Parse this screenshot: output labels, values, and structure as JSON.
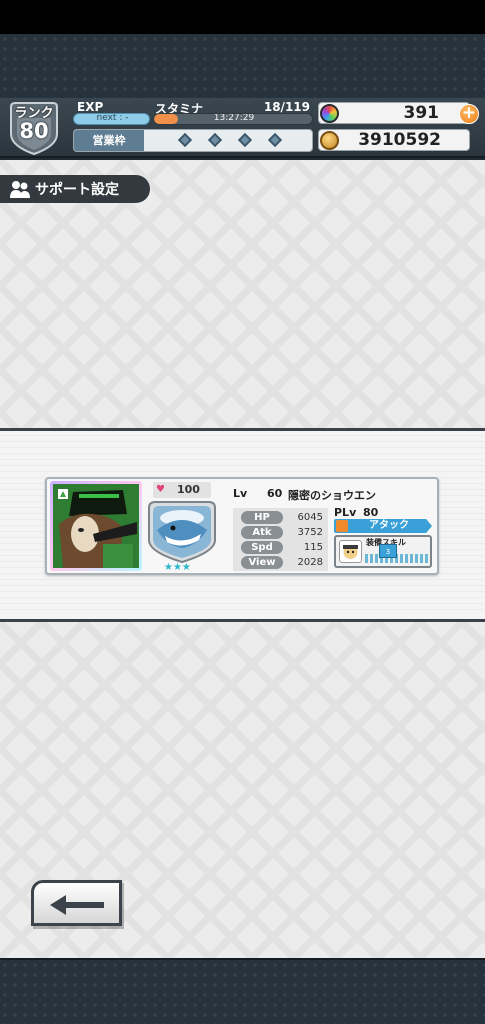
{
  "header": {
    "rank_label": "ランク",
    "rank_value": "80",
    "exp_label": "EXP",
    "exp_next": "next :  -",
    "stamina_label": "スタミナ",
    "stamina_count": "18/119",
    "stamina_fraction": 0.15,
    "stamina_timer": "13:27:29",
    "business_label": "営業枠",
    "business_slots": 4,
    "gems": "391",
    "coins": "3910592",
    "plus_symbol": "+"
  },
  "page": {
    "title": "サポート設定"
  },
  "support_card": {
    "affinity": "100",
    "lv_label": "Lv",
    "level": "60",
    "name": "隠密のショウエン",
    "stats": [
      {
        "label": "HP",
        "value": "6045"
      },
      {
        "label": "Atk",
        "value": "3752"
      },
      {
        "label": "Spd",
        "value": "115"
      },
      {
        "label": "View",
        "value": "2028"
      }
    ],
    "plv_label": "PLv",
    "plv": "80",
    "role": "アタック",
    "skill_title": "装備スキル",
    "skill_level": "3",
    "stars": "★★★",
    "heart": "♥"
  },
  "icons": {
    "rank_badge": "shield-icon",
    "gem": "gem-icon",
    "coin": "coin-icon",
    "plus": "plus-icon",
    "support": "group-icon",
    "back": "back-arrow-icon",
    "attribute": "triangle-attribute-icon"
  },
  "colors": {
    "accent_orange": "#f0904a",
    "exp_blue": "#8ecbe6",
    "role_blue": "#3aa0d8",
    "header_bg": "#2b353d"
  }
}
